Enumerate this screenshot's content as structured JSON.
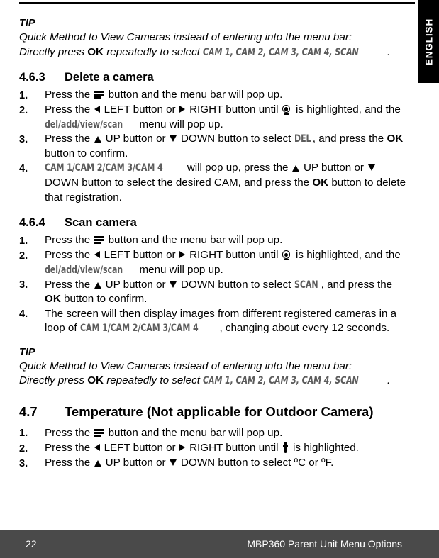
{
  "language_tab": {
    "label": "ENGLISH"
  },
  "tip_top": {
    "label": "TIP",
    "line1": "Quick Method to View Cameras instead of entering into the menu bar:",
    "line2_pre": "Directly press ",
    "line2_bold": "OK",
    "line2_mid": " repeatedly to select ",
    "line2_device": "CAM 1, CAM 2, CAM 3, CAM 4, SCAN",
    "line2_end": "."
  },
  "section_463": {
    "number": "4.6.3",
    "title": "Delete a camera",
    "steps": [
      {
        "marker": "1.",
        "parts": [
          {
            "t": "text",
            "v": "Press the "
          },
          {
            "t": "icon",
            "v": "menu-icon"
          },
          {
            "t": "text",
            "v": " button and the menu bar will pop up."
          }
        ]
      },
      {
        "marker": "2.",
        "parts": [
          {
            "t": "text",
            "v": "Press the "
          },
          {
            "t": "icon",
            "v": "arrow-left-icon"
          },
          {
            "t": "text",
            "v": " LEFT button or "
          },
          {
            "t": "icon",
            "v": "arrow-right-icon"
          },
          {
            "t": "text",
            "v": " RIGHT button until "
          },
          {
            "t": "icon",
            "v": "camera-icon"
          },
          {
            "t": "text",
            "v": "  is highlighted, and the "
          },
          {
            "t": "device",
            "v": "del/add/view/scan"
          },
          {
            "t": "text",
            "v": " menu will pop up."
          }
        ]
      },
      {
        "marker": "3.",
        "parts": [
          {
            "t": "text",
            "v": "Press the "
          },
          {
            "t": "icon",
            "v": "arrow-up-icon"
          },
          {
            "t": "text",
            "v": " UP button or "
          },
          {
            "t": "icon",
            "v": "arrow-down-icon"
          },
          {
            "t": "text",
            "v": " DOWN button to select "
          },
          {
            "t": "device",
            "v": "DEL"
          },
          {
            "t": "text",
            "v": ", and press the "
          },
          {
            "t": "bold",
            "v": "OK"
          },
          {
            "t": "text",
            "v": " button to confirm."
          }
        ]
      },
      {
        "marker": "4.",
        "parts": [
          {
            "t": "device",
            "v": "CAM 1/CAM 2/CAM 3/CAM 4"
          },
          {
            "t": "text",
            "v": " will pop up, press the "
          },
          {
            "t": "icon",
            "v": "arrow-up-icon"
          },
          {
            "t": "text",
            "v": " UP button or "
          },
          {
            "t": "icon",
            "v": "arrow-down-icon"
          },
          {
            "t": "text",
            "v": " DOWN button to select the desired CAM, and press the "
          },
          {
            "t": "bold",
            "v": "OK"
          },
          {
            "t": "text",
            "v": " button to delete that registration."
          }
        ]
      }
    ]
  },
  "section_464": {
    "number": "4.6.4",
    "title": "Scan camera",
    "steps": [
      {
        "marker": "1.",
        "parts": [
          {
            "t": "text",
            "v": "Press the "
          },
          {
            "t": "icon",
            "v": "menu-icon"
          },
          {
            "t": "text",
            "v": " button and the menu bar will pop up."
          }
        ]
      },
      {
        "marker": "2.",
        "parts": [
          {
            "t": "text",
            "v": "Press the "
          },
          {
            "t": "icon",
            "v": "arrow-left-icon"
          },
          {
            "t": "text",
            "v": " LEFT button or "
          },
          {
            "t": "icon",
            "v": "arrow-right-icon"
          },
          {
            "t": "text",
            "v": " RIGHT button until "
          },
          {
            "t": "icon",
            "v": "camera-icon"
          },
          {
            "t": "text",
            "v": "  is highlighted, and the "
          },
          {
            "t": "device",
            "v": "del/add/view/scan"
          },
          {
            "t": "text",
            "v": " menu will pop up."
          }
        ]
      },
      {
        "marker": "3.",
        "parts": [
          {
            "t": "text",
            "v": "Press the "
          },
          {
            "t": "icon",
            "v": "arrow-up-icon"
          },
          {
            "t": "text",
            "v": " UP button or "
          },
          {
            "t": "icon",
            "v": "arrow-down-icon"
          },
          {
            "t": "text",
            "v": " DOWN button to select "
          },
          {
            "t": "device",
            "v": "SCAN"
          },
          {
            "t": "text",
            "v": ", and press the "
          },
          {
            "t": "bold",
            "v": "OK"
          },
          {
            "t": "text",
            "v": " button to confirm."
          }
        ]
      },
      {
        "marker": "4.",
        "parts": [
          {
            "t": "text",
            "v": "The screen will then display images from different registered cameras in a loop of "
          },
          {
            "t": "device",
            "v": "CAM 1/CAM 2/CAM 3/CAM 4"
          },
          {
            "t": "text",
            "v": ", changing about every 12 seconds."
          }
        ]
      }
    ]
  },
  "tip_bottom": {
    "label": "TIP",
    "line1": "Quick Method to View Cameras instead of entering into the menu bar:",
    "line2_pre": "Directly press ",
    "line2_bold": "OK",
    "line2_mid": " repeatedly to select ",
    "line2_device": "CAM 1, CAM 2, CAM 3, CAM 4, SCAN",
    "line2_end": "."
  },
  "section_47": {
    "number": "4.7",
    "title": "Temperature (Not applicable for Outdoor Camera)",
    "steps": [
      {
        "marker": "1.",
        "parts": [
          {
            "t": "text",
            "v": "Press the "
          },
          {
            "t": "icon",
            "v": "menu-icon"
          },
          {
            "t": "text",
            "v": " button and the menu bar will pop up."
          }
        ]
      },
      {
        "marker": "2.",
        "parts": [
          {
            "t": "text",
            "v": "Press the "
          },
          {
            "t": "icon",
            "v": "arrow-left-icon"
          },
          {
            "t": "text",
            "v": " LEFT button or "
          },
          {
            "t": "icon",
            "v": "arrow-right-icon"
          },
          {
            "t": "text",
            "v": " RIGHT button until "
          },
          {
            "t": "icon",
            "v": "thermometer-icon"
          },
          {
            "t": "text",
            "v": "  is highlighted."
          }
        ]
      },
      {
        "marker": "3.",
        "parts": [
          {
            "t": "text",
            "v": "Press the "
          },
          {
            "t": "icon",
            "v": "arrow-up-icon"
          },
          {
            "t": "text",
            "v": " UP button or "
          },
          {
            "t": "icon",
            "v": "arrow-down-icon"
          },
          {
            "t": "text",
            "v": " DOWN button to select ºC or ºF."
          }
        ]
      }
    ]
  },
  "footer": {
    "page_number": "22",
    "title": "MBP360 Parent Unit Menu Options",
    "background_color": "#4a4a4a"
  }
}
